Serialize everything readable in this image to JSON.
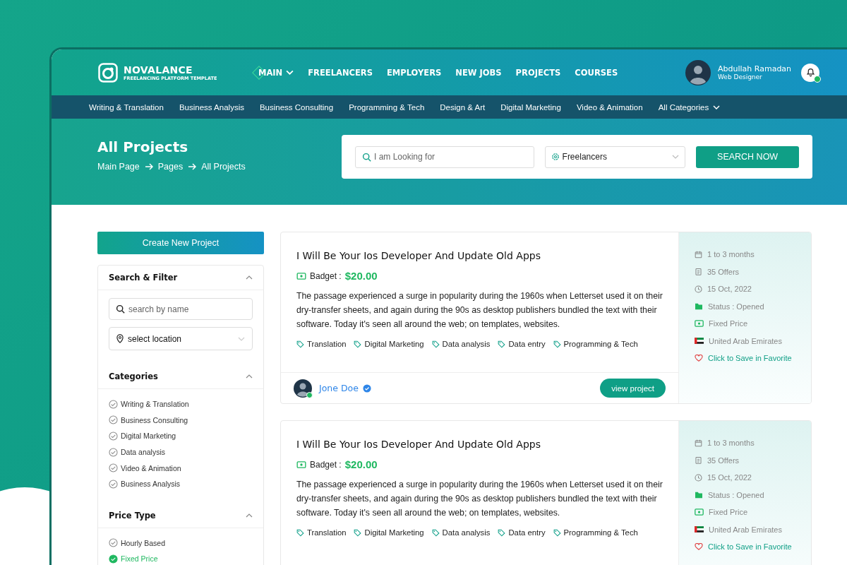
{
  "brand": {
    "name": "NOVALANCE",
    "tagline": "FREELANCING PLATFORM TEMPLATE"
  },
  "nav": [
    {
      "label": "MAIN",
      "selected": true,
      "dropdown": true
    },
    {
      "label": "FREELANCERS",
      "selected": false,
      "dropdown": false
    },
    {
      "label": "EMPLOYERS",
      "selected": false,
      "dropdown": false
    },
    {
      "label": "NEW JOBS",
      "selected": false,
      "dropdown": false
    },
    {
      "label": "PROJECTS",
      "selected": false,
      "dropdown": false
    },
    {
      "label": "COURSES",
      "selected": false,
      "dropdown": false
    }
  ],
  "user": {
    "name": "Abdullah Ramadan",
    "role": "Web Designer",
    "online": true
  },
  "categories_bar": [
    {
      "label": "Writing & Translation",
      "dropdown": false
    },
    {
      "label": "Business Analysis",
      "dropdown": false
    },
    {
      "label": "Business Consulting",
      "dropdown": false
    },
    {
      "label": "Programming & Tech",
      "dropdown": false
    },
    {
      "label": "Design & Art",
      "dropdown": false
    },
    {
      "label": "Digital Marketing",
      "dropdown": false
    },
    {
      "label": "Video & Animation",
      "dropdown": false
    },
    {
      "label": "All Categories",
      "dropdown": true
    }
  ],
  "hero": {
    "title": "All Projects",
    "breadcrumb": [
      "Main Page",
      "Pages",
      "All Projects"
    ]
  },
  "search": {
    "placeholder": "I am Looking for",
    "type_value": "Freelancers",
    "button": "SEARCH NOW"
  },
  "sidebar": {
    "create_button": "Create New Project",
    "filter": {
      "title": "Search & Filter",
      "expanded": true,
      "name_placeholder": "search by name",
      "location_value": "select location"
    },
    "categories": {
      "title": "Categories",
      "expanded": true,
      "items": [
        {
          "label": "Writing & Translation",
          "checked": false
        },
        {
          "label": "Business Consulting",
          "checked": false
        },
        {
          "label": "Digital Marketing",
          "checked": false
        },
        {
          "label": "Data analysis",
          "checked": false
        },
        {
          "label": "Video & Animation",
          "checked": false
        },
        {
          "label": "Business Analysis",
          "checked": false
        }
      ]
    },
    "price_type": {
      "title": "Price Type",
      "expanded": true,
      "items": [
        {
          "label": "Hourly Based",
          "checked": false
        },
        {
          "label": "Fixed Price",
          "checked": true
        }
      ]
    }
  },
  "projects": [
    {
      "title": "I Will Be Your Ios Developer And Update Old Apps",
      "budget_label": "Badget :",
      "budget": "$20.00",
      "description": "The passage experienced a surge in popularity during the 1960s when Letterset used it on their dry-transfer sheets, and again during the 90s as desktop publishers bundled the text with their software. Today it's seen all around the web; on templates, websites.",
      "tags": [
        "Translation",
        "Digital Marketing",
        "Data analysis",
        "Data entry",
        "Programming & Tech"
      ],
      "duration": "1 to 3 months",
      "offers": "35 Offers",
      "date": "15 Oct, 2022",
      "status": "Status : Opened",
      "price_type": "Fixed Price",
      "country": "United Arab Emirates",
      "favorite": "Click to Save in Favorite",
      "author": {
        "name": "Jone Doe",
        "verified": true,
        "online": true
      },
      "button": "view project"
    },
    {
      "title": "I Will Be Your Ios Developer And Update Old Apps",
      "budget_label": "Badget :",
      "budget": "$20.00",
      "description": "The passage experienced a surge in popularity during the 1960s when Letterset used it on their dry-transfer sheets, and again during the 90s as desktop publishers bundled the text with their software. Today it's seen all around the web; on templates, websites.",
      "tags": [
        "Translation",
        "Digital Marketing",
        "Data analysis",
        "Data entry",
        "Programming & Tech"
      ],
      "duration": "1 to 3 months",
      "offers": "35 Offers",
      "date": "15 Oct, 2022",
      "status": "Status : Opened",
      "price_type": "Fixed Price",
      "country": "United Arab Emirates",
      "favorite": "Click to Save in Favorite"
    }
  ]
}
